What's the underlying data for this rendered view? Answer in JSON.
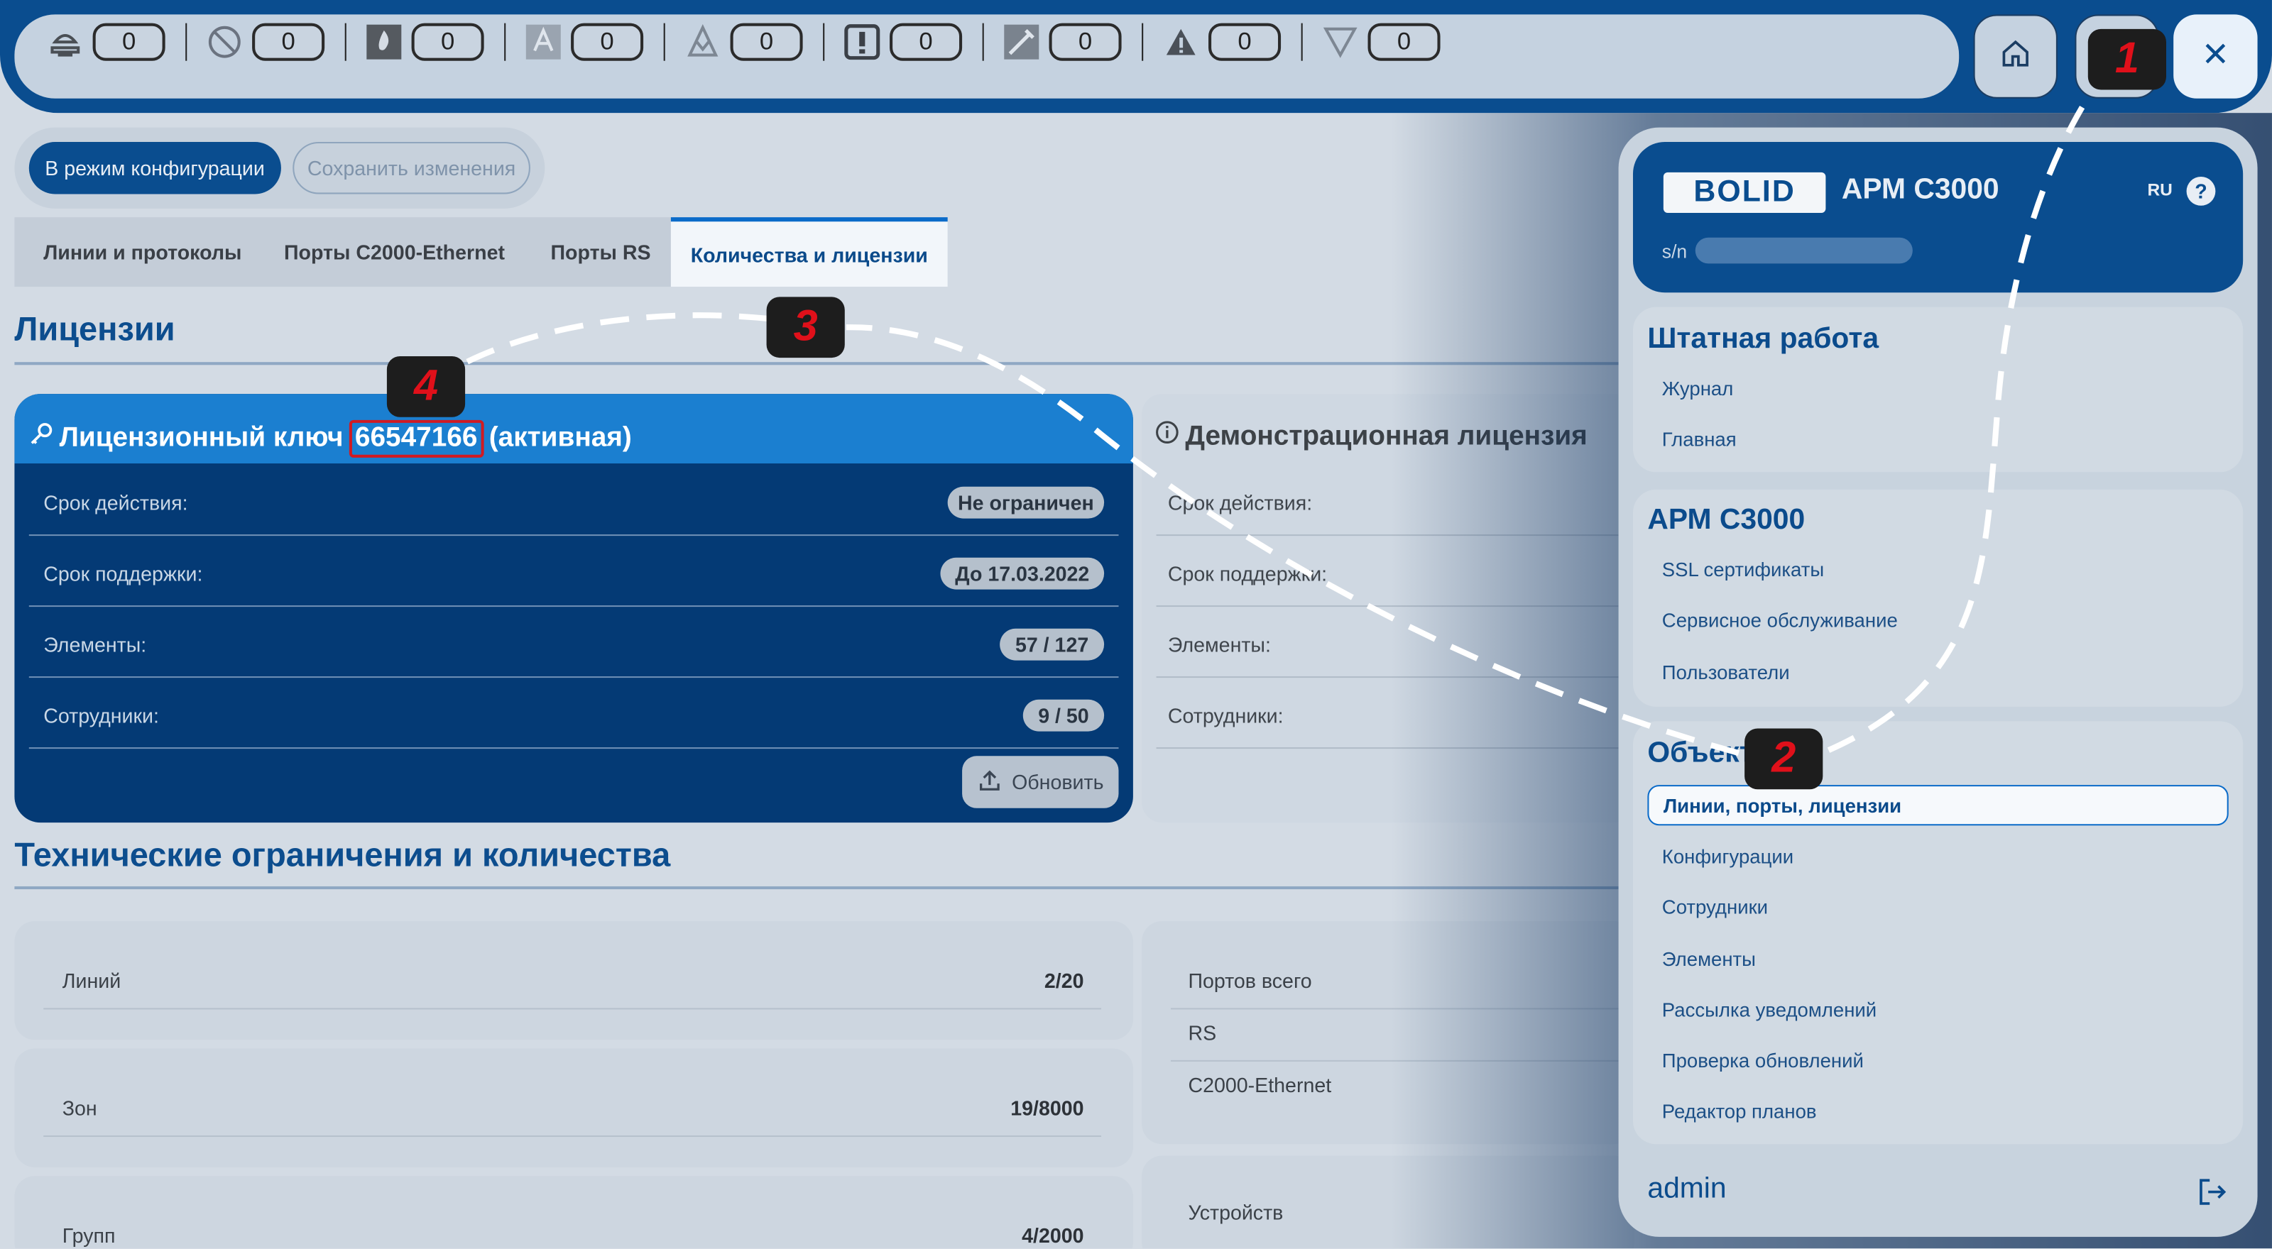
{
  "topbar": {
    "counters": [
      {
        "icon": "fire-alarm-icon",
        "value": "0"
      },
      {
        "icon": "disabled-icon",
        "value": "0"
      },
      {
        "icon": "flame-icon",
        "value": "0"
      },
      {
        "icon": "alert-a-icon",
        "value": "0"
      },
      {
        "icon": "warning-down-icon",
        "value": "0"
      },
      {
        "icon": "exclamation-icon",
        "value": "0"
      },
      {
        "icon": "tool-icon",
        "value": "0"
      },
      {
        "icon": "triangle-alert-icon",
        "value": "0"
      },
      {
        "icon": "triangle-down-icon",
        "value": "0"
      }
    ]
  },
  "mode": {
    "config_label": "В режим конфигурации",
    "save_label": "Сохранить изменения"
  },
  "tabs": [
    {
      "label": "Линии и протоколы"
    },
    {
      "label": "Порты C2000-Ethernet"
    },
    {
      "label": "Порты RS"
    },
    {
      "label": "Количества и лицензии"
    }
  ],
  "licenses": {
    "heading": "Лицензии",
    "card": {
      "title_prefix": "Лицензионный ключ",
      "key": "66547166",
      "status": "(активная)",
      "rows": [
        {
          "label": "Срок действия:",
          "value": "Не ограничен"
        },
        {
          "label": "Срок поддержки:",
          "value": "До 17.03.2022"
        },
        {
          "label": "Элементы:",
          "value": "57 / 127"
        },
        {
          "label": "Сотрудники:",
          "value": "9 / 50"
        }
      ],
      "update_label": "Обновить"
    },
    "demo": {
      "title": "Демонстрационная лицензия",
      "rows": [
        {
          "label": "Срок действия:"
        },
        {
          "label": "Срок поддержки:"
        },
        {
          "label": "Элементы:"
        },
        {
          "label": "Сотрудники:"
        }
      ]
    }
  },
  "tech": {
    "heading": "Технические ограничения и количества",
    "left": [
      {
        "label": "Линий",
        "value": "2/20"
      },
      {
        "label": "Зон",
        "value": "19/8000"
      },
      {
        "label": "Групп",
        "value": "4/2000"
      }
    ],
    "right": [
      {
        "label": "Портов всего"
      },
      {
        "label": "RS"
      },
      {
        "label": "C2000-Ethernet"
      },
      {
        "label": "Устройств"
      }
    ]
  },
  "panel": {
    "brand": "BOLID",
    "product": "АРМ С3000",
    "lang": "RU",
    "sn_label": "s/n",
    "sections": [
      {
        "title": "Штатная работа",
        "items": [
          "Журнал",
          "Главная"
        ]
      },
      {
        "title": "АРМ С3000",
        "items": [
          "SSL сертификаты",
          "Сервисное обслуживание",
          "Пользователи"
        ]
      },
      {
        "title": "Объекты",
        "active": "Линии, порты, лицензии",
        "items": [
          "Конфигурации",
          "Сотрудники",
          "Элементы",
          "Рассылка уведомлений",
          "Проверка обновлений",
          "Редактор планов"
        ]
      }
    ],
    "user": "admin"
  },
  "annotations": {
    "m1": "1",
    "m2": "2",
    "m3": "3",
    "m4": "4"
  },
  "colors": {
    "primary": "#0a4d8f",
    "accent": "#1b7fd0",
    "marker_text": "#e0101a"
  }
}
